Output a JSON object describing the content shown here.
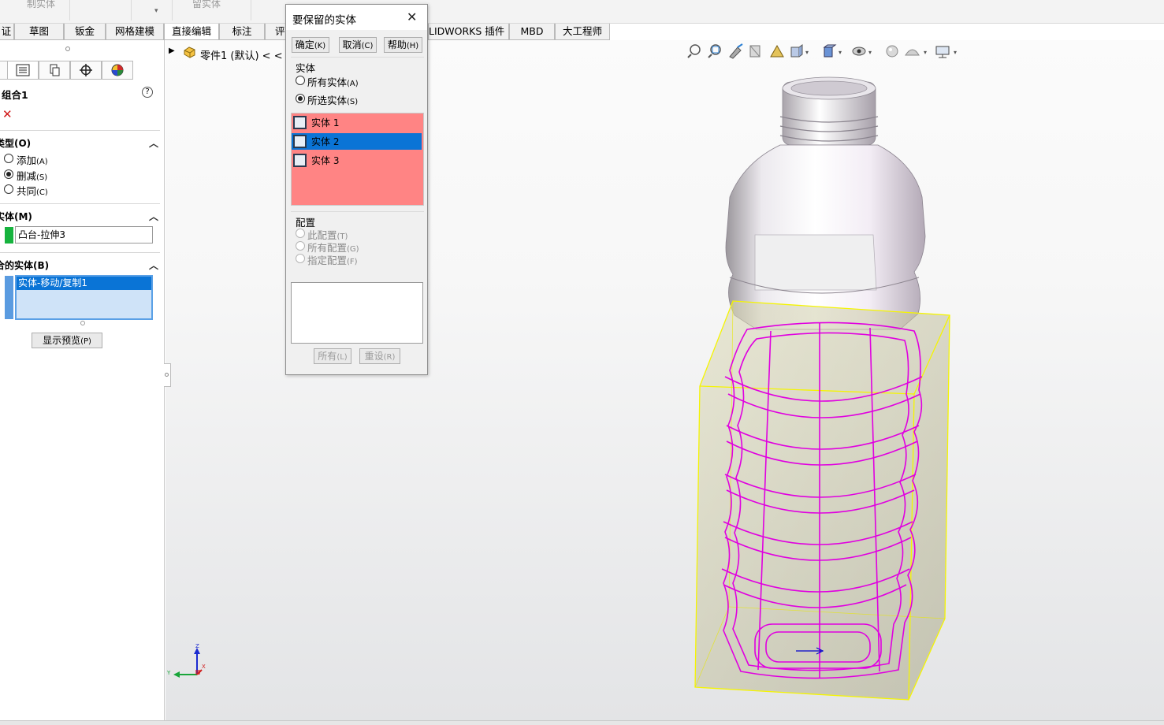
{
  "ribbon": {
    "labels": [
      "制实体",
      "留实体"
    ]
  },
  "tabs": [
    {
      "label": "证"
    },
    {
      "label": "草图"
    },
    {
      "label": "钣金"
    },
    {
      "label": "网格建模"
    },
    {
      "label": "直接编辑"
    },
    {
      "label": "标注"
    },
    {
      "label": "评"
    },
    {
      "label": "LIDWORKS 插件"
    },
    {
      "label": "MBD"
    },
    {
      "label": "大工程师"
    }
  ],
  "tree": {
    "node_label": "零件1 (默认) < <"
  },
  "property_manager": {
    "title": "组合1",
    "help": "?",
    "close": "✕",
    "operation_type": {
      "header": "类型(O)",
      "options": [
        {
          "label": "添加",
          "key": "(A)",
          "selected": false
        },
        {
          "label": "删减",
          "key": "(S)",
          "selected": true
        },
        {
          "label": "共同",
          "key": "(C)",
          "selected": false
        }
      ]
    },
    "main_body": {
      "header": "实体(M)",
      "value": "凸台-拉伸3"
    },
    "bodies_to_combine": {
      "header": "合的实体(B)",
      "items": [
        "实体-移动/复制1"
      ]
    },
    "show_preview": {
      "label": "显示预览",
      "key": "(P)"
    }
  },
  "dialog": {
    "title": "要保留的实体",
    "buttons": {
      "ok": {
        "label": "确定",
        "key": "(K)"
      },
      "cancel": {
        "label": "取消",
        "key": "(C)"
      },
      "help": {
        "label": "帮助",
        "key": "(H)"
      }
    },
    "bodies_section": {
      "header": "实体",
      "options": [
        {
          "label": "所有实体",
          "key": "(A)",
          "selected": false
        },
        {
          "label": "所选实体",
          "key": "(S)",
          "selected": true
        }
      ],
      "list": [
        {
          "label": "实体 1",
          "selected": false
        },
        {
          "label": "实体 2",
          "selected": true
        },
        {
          "label": "实体 3",
          "selected": false
        }
      ]
    },
    "config_section": {
      "header": "配置",
      "options": [
        {
          "label": "此配置",
          "key": "(T)"
        },
        {
          "label": "所有配置",
          "key": "(G)"
        },
        {
          "label": "指定配置",
          "key": "(F)"
        }
      ]
    },
    "footer_buttons": {
      "all": {
        "label": "所有",
        "key": "(L)"
      },
      "reset": {
        "label": "重设",
        "key": "(R)"
      }
    }
  },
  "triad": {
    "z": "Z",
    "y": "Y",
    "x": "X"
  },
  "colors": {
    "selection_blue": "#0a74d6",
    "list_bg": "#ff8484",
    "highlight_magenta": "#e000e0",
    "highlight_yellow": "#f5f500",
    "main_body_swatch": "#16b33e"
  },
  "view_toolbar_icons": [
    "zoom-to-fit-icon",
    "zoom-area-icon",
    "previous-view-icon",
    "section-view-icon",
    "dynamic-annotation-icon",
    "view-orientation-icon",
    "display-style-icon",
    "hide-show-icon",
    "edit-appearance-icon",
    "apply-scene-icon",
    "view-settings-icon"
  ]
}
